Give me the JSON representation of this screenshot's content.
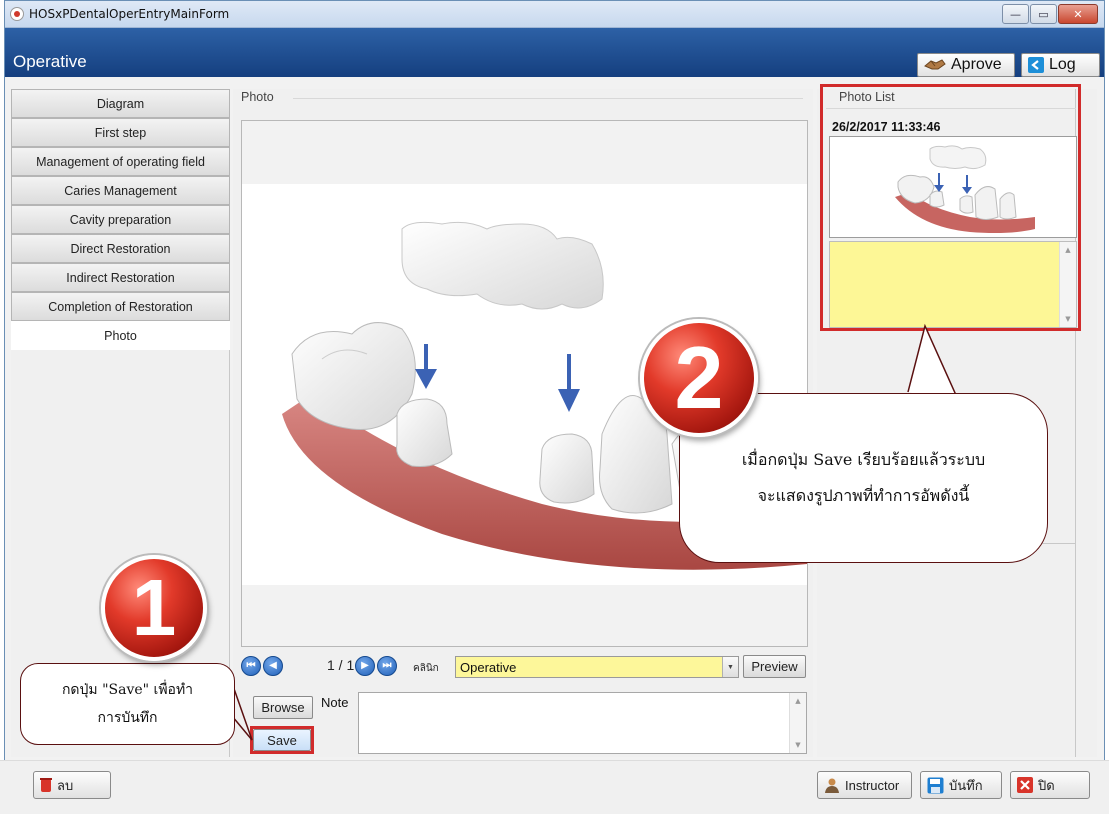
{
  "window": {
    "title": "HOSxPDentalOperEntryMainForm",
    "page_title": "Operative",
    "min_glyph": "—",
    "max_glyph": "▭",
    "close_glyph": "✕"
  },
  "header": {
    "approve_label": "Aprove",
    "log_label": "Log"
  },
  "sidebar": {
    "items": [
      {
        "label": "Diagram"
      },
      {
        "label": "First step"
      },
      {
        "label": "Management of operating field"
      },
      {
        "label": "Caries Management"
      },
      {
        "label": "Cavity preparation"
      },
      {
        "label": "Direct Restoration"
      },
      {
        "label": "Indirect Restoration"
      },
      {
        "label": "Completion of Restoration"
      },
      {
        "label": "Photo"
      }
    ],
    "active_item": "Photo"
  },
  "photo": {
    "group_title": "Photo",
    "page_counter": "1 / 1",
    "clinic_label": "คลินิก",
    "clinic_value": "Operative",
    "preview_label": "Preview",
    "browse_label": "Browse",
    "note_label": "Note",
    "note_value": "",
    "save_label": "Save"
  },
  "photo_list": {
    "title": "Photo List",
    "items": [
      {
        "date": "26/2/2017 11:33:46"
      }
    ]
  },
  "bottom": {
    "delete_label": "ลบ",
    "instructor_label": "Instructor",
    "save_label": "บันทึก",
    "close_label": "ปิด"
  },
  "annotations": {
    "step1_number": "1",
    "step1_line1": "กดปุ่ม \"Save\" เพื่อทำ",
    "step1_line2": "การบันทึก",
    "step2_number": "2",
    "step2_line1": "เมื่อกดปุ่ม Save เรียบร้อยแล้วระบบ",
    "step2_line2": "จะแสดงรูปภาพที่ทำการอัพดังนี้",
    "highlight_color": "#d12b2b"
  }
}
